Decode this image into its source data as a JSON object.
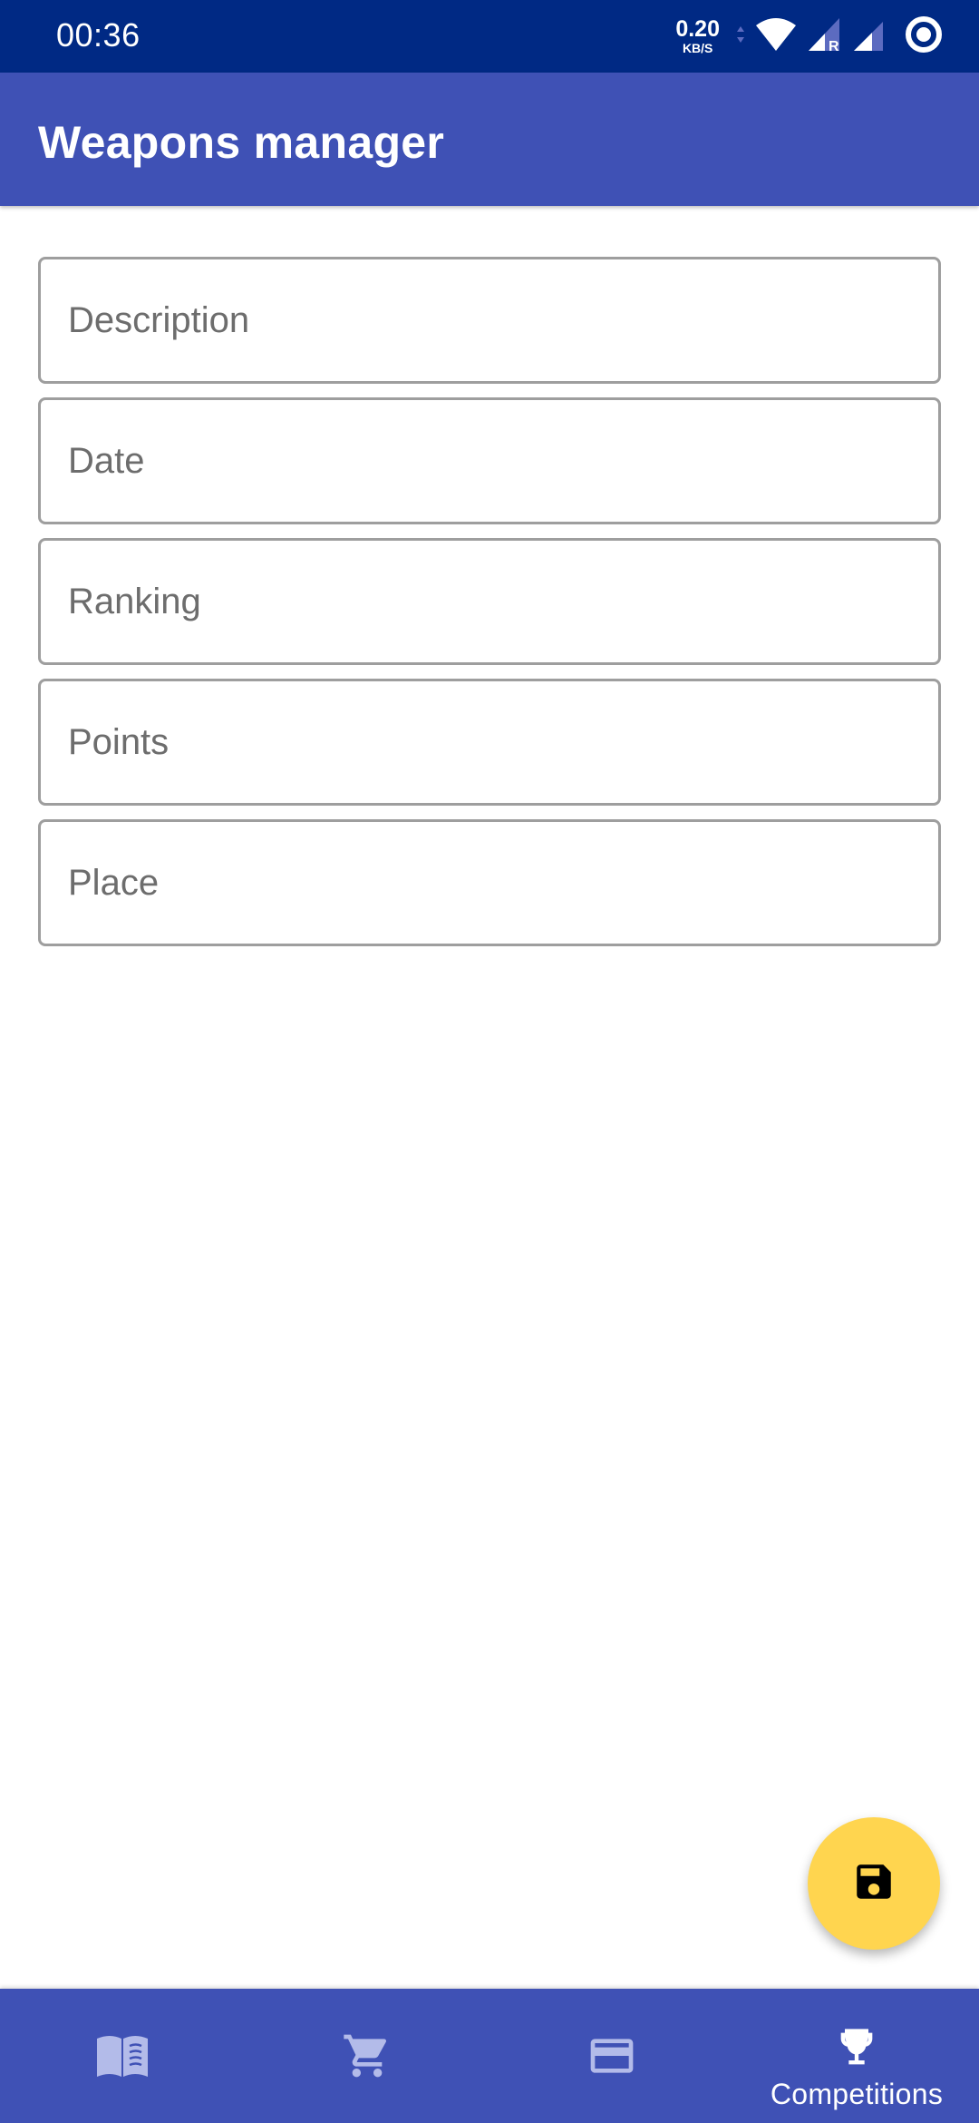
{
  "status_bar": {
    "time": "00:36",
    "net_speed_value": "0.20",
    "net_speed_unit": "KB/S",
    "icons": [
      "data-transfer-icon",
      "wifi-icon",
      "signal-roaming-icon",
      "signal-icon",
      "record-icon"
    ],
    "roaming_label": "R"
  },
  "app_bar": {
    "title": "Weapons manager"
  },
  "form": {
    "fields": [
      {
        "name": "description",
        "placeholder": "Description",
        "value": ""
      },
      {
        "name": "date",
        "placeholder": "Date",
        "value": ""
      },
      {
        "name": "ranking",
        "placeholder": "Ranking",
        "value": ""
      },
      {
        "name": "points",
        "placeholder": "Points",
        "value": ""
      },
      {
        "name": "place",
        "placeholder": "Place",
        "value": ""
      }
    ]
  },
  "fab": {
    "icon": "save-icon",
    "action": "Save"
  },
  "bottom_nav": {
    "items": [
      {
        "icon": "book-icon",
        "label": "",
        "active": false
      },
      {
        "icon": "cart-icon",
        "label": "",
        "active": false
      },
      {
        "icon": "credit-card-icon",
        "label": "",
        "active": false
      },
      {
        "icon": "trophy-icon",
        "label": "Competitions",
        "active": true
      }
    ]
  },
  "colors": {
    "status_bar": "#002984",
    "primary": "#3f51b5",
    "accent": "#ffd54f",
    "nav_inactive": "#b3bbe9",
    "nav_active": "#ffffff",
    "field_border": "#9e9e9e",
    "placeholder": "#6d6d6d"
  }
}
